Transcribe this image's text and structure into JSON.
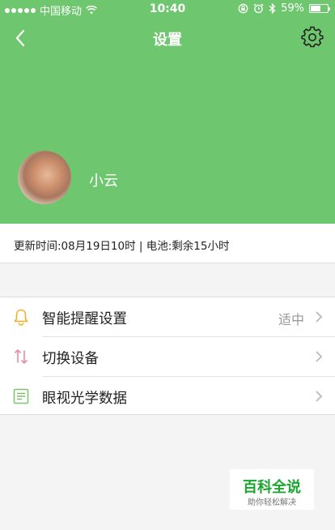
{
  "status_bar": {
    "carrier": "中国移动",
    "time": "10:40",
    "battery_percent": "59%",
    "battery_level": 0.59,
    "signal_icon": "signal-dots-icon",
    "wifi_icon": "wifi-icon",
    "orientation_lock_icon": "orientation-lock-icon",
    "alarm_icon": "alarm-clock-icon",
    "bluetooth_icon": "bluetooth-icon"
  },
  "navbar": {
    "title": "设置",
    "back_icon": "back-arrow-icon",
    "settings_icon": "gear-icon"
  },
  "profile": {
    "username": "小云"
  },
  "info": {
    "text": "更新时间:08月19日10时 | 电池:剩余15小时"
  },
  "menu": {
    "items": [
      {
        "label": "智能提醒设置",
        "value": "适中",
        "icon": "bell-icon"
      },
      {
        "label": "切换设备",
        "value": "",
        "icon": "swap-arrows-icon"
      },
      {
        "label": "眼视光学数据",
        "value": "",
        "icon": "document-list-icon"
      }
    ]
  },
  "watermark": {
    "title": "百科全说",
    "subtitle": "助你轻松解决"
  },
  "colors": {
    "header_green": "#6ec66f",
    "bell_orange": "#f2b027",
    "swap_pink": "#e98aa6",
    "doc_green": "#7fc26b",
    "watermark_green": "#19a72f"
  }
}
